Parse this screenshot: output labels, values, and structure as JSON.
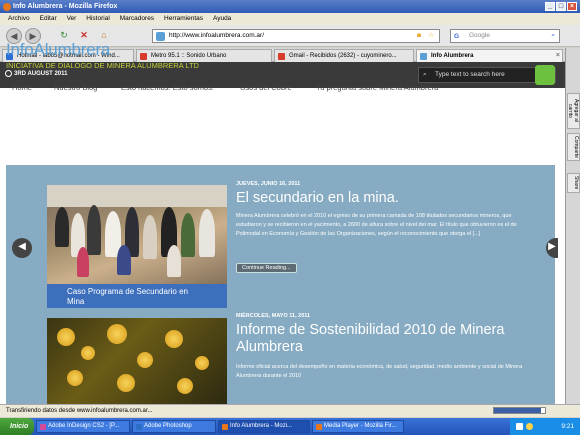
{
  "window": {
    "title": "Info Alumbrera - Mozilla Firefox"
  },
  "menu": [
    "Archivo",
    "Editar",
    "Ver",
    "Historial",
    "Marcadores",
    "Herramientas",
    "Ayuda"
  ],
  "address": {
    "url": "http://www.infoalumbrera.com.ar/",
    "search_placeholder": "Google"
  },
  "tabs": [
    {
      "label": "Hotmail - lab65@hotmail.com - Wind...",
      "icon_color": "#2b6fd6"
    },
    {
      "label": "Metro 95.1 :: Sonido Urbano",
      "icon_color": "#d63b2b"
    },
    {
      "label": "Gmail - Recibidos (2632) - cuyominero...",
      "icon_color": "#d63b2b"
    },
    {
      "label": "Info Alumbrera",
      "icon_color": "#5aa0d6",
      "active": true
    }
  ],
  "site": {
    "date": "3RD AUGUST 2011",
    "search_placeholder": "Type text to search here",
    "logo": "InfoAlumbrera",
    "tagline": "INICIATIVA DE DIALOGO DE MINERA ALUMBRERA LTD",
    "nav": [
      "Home",
      "Nuestro Blog",
      "Esto hacemos. Esto somos.",
      "Usos del Cobre",
      "Tu pregunta sobre Minera Alumbrera"
    ],
    "posts": [
      {
        "meta": "JUEVES, JUNIO 16, 2011",
        "title": "El secundario en la mina.",
        "excerpt": "Minera Alumbrera celebró en el 2010 el egreso de su primera camada de 108 titulados secundarios mineros, que estudiaron y se recibieron en el yacimiento, a 2600 de altura sobre el nivel del mar. El título que obtuvieron es el de Polimodal en Economía y Gestión de las Organizaciones, según el reconocimiento que otorga el [...]",
        "more": "Continue Reading...",
        "caption": "Caso Programa de Secundario en Mina"
      },
      {
        "meta": "MIÉRCOLES, MAYO 11, 2011",
        "title": "Informe de Sostenibilidad 2010 de Minera Alumbrera",
        "excerpt": "Informe oficial acerca del desempeño en materia económica, de salud, seguridad, medio ambiente y social de Minera Alumbrera durante el 2010"
      }
    ]
  },
  "status": {
    "text": "Transfiriendo datos desde www.infoalumbrera.com.ar...",
    "progress": 0.92
  },
  "taskbar": {
    "start": "Inicio",
    "items": [
      {
        "label": "Adobe InDesign CS2 - [P...",
        "icon_color": "#d44a9a"
      },
      {
        "label": "Adobe Photoshop",
        "icon_color": "#2a6fc4"
      },
      {
        "label": "Info Alumbrera - Mozi...",
        "icon_color": "#e8761a",
        "active": true
      },
      {
        "label": "Media Player - Mozilla Fir...",
        "icon_color": "#e8761a"
      }
    ],
    "clock": "9:21"
  },
  "sidebar_tabs": [
    "Agregar al carrito",
    "Comparte",
    "Share"
  ]
}
